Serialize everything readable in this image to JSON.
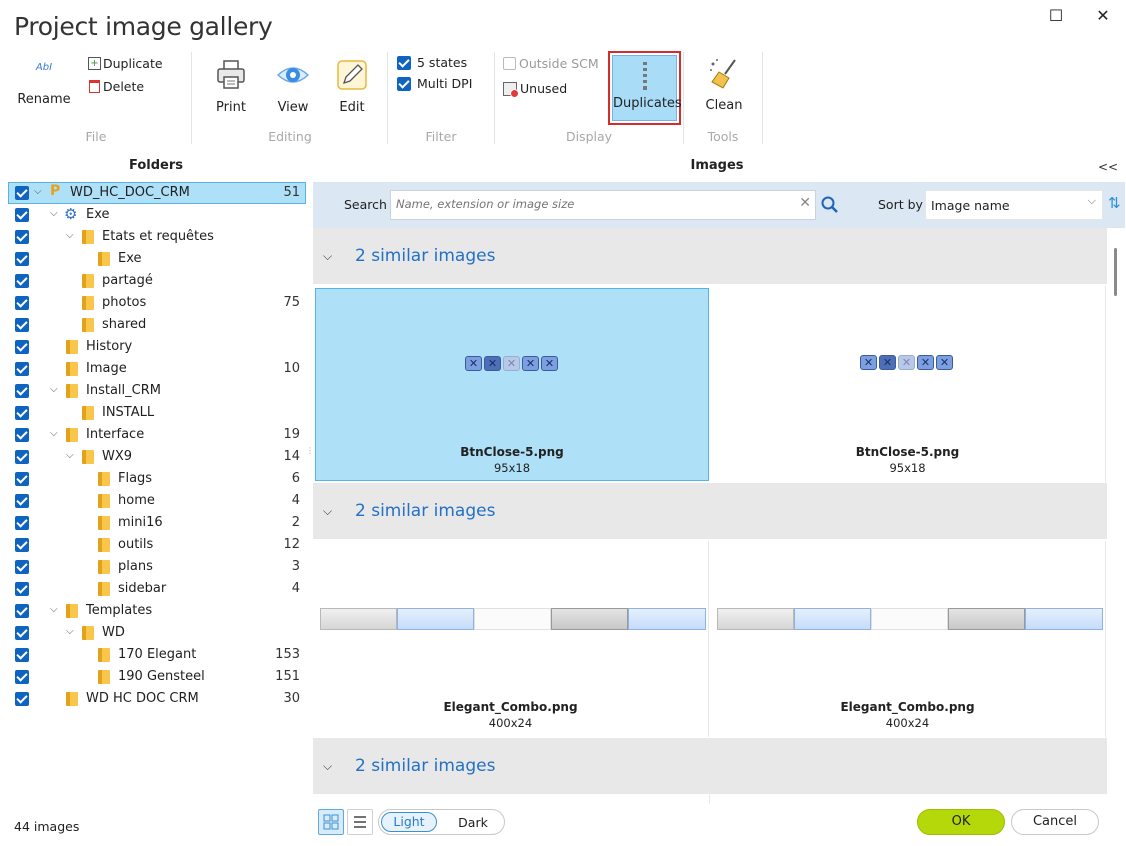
{
  "window": {
    "title": "Project image gallery",
    "maximize_glyph": "☐",
    "close_glyph": "✕"
  },
  "ribbon": {
    "file": {
      "rename": "Rename",
      "duplicate": "Duplicate",
      "delete": "Delete",
      "group": "File"
    },
    "editing": {
      "print": "Print",
      "view": "View",
      "edit": "Edit",
      "group": "Editing"
    },
    "filter": {
      "five_states": "5 states",
      "multi_dpi": "Multi DPI",
      "group": "Filter"
    },
    "display": {
      "outside_scm": "Outside SCM",
      "unused": "Unused",
      "duplicates": "Duplicates",
      "group": "Display"
    },
    "tools": {
      "clean": "Clean",
      "group": "Tools"
    }
  },
  "folders": {
    "title": "Folders",
    "items": [
      {
        "label": "WD_HC_DOC_CRM",
        "count": "51"
      },
      {
        "label": "Exe",
        "count": ""
      },
      {
        "label": "Etats et requêtes",
        "count": ""
      },
      {
        "label": "Exe",
        "count": ""
      },
      {
        "label": "partagé",
        "count": ""
      },
      {
        "label": "photos",
        "count": "75"
      },
      {
        "label": "shared",
        "count": ""
      },
      {
        "label": "History",
        "count": ""
      },
      {
        "label": "Image",
        "count": "10"
      },
      {
        "label": "Install_CRM",
        "count": ""
      },
      {
        "label": "INSTALL",
        "count": ""
      },
      {
        "label": "Interface",
        "count": "19"
      },
      {
        "label": "WX9",
        "count": "14"
      },
      {
        "label": "Flags",
        "count": "6"
      },
      {
        "label": "home",
        "count": "4"
      },
      {
        "label": "mini16",
        "count": "2"
      },
      {
        "label": "outils",
        "count": "12"
      },
      {
        "label": "plans",
        "count": "3"
      },
      {
        "label": "sidebar",
        "count": "4"
      },
      {
        "label": "Templates",
        "count": ""
      },
      {
        "label": "WD",
        "count": ""
      },
      {
        "label": "170 Elegant",
        "count": "153"
      },
      {
        "label": "190 Gensteel",
        "count": "151"
      },
      {
        "label": "WD HC DOC CRM",
        "count": "30"
      }
    ]
  },
  "images": {
    "title": "Images",
    "collapse": "<<",
    "search_label": "Search",
    "search_placeholder": "Name, extension or image size",
    "sort_label": "Sort by",
    "sort_value": "Image name",
    "groups": [
      {
        "label": "2 similar images",
        "items": [
          {
            "name": "BtnClose-5.png",
            "dim": "95x18"
          },
          {
            "name": "BtnClose-5.png",
            "dim": "95x18"
          }
        ]
      },
      {
        "label": "2 similar images",
        "items": [
          {
            "name": "Elegant_Combo.png",
            "dim": "400x24"
          },
          {
            "name": "Elegant_Combo.png",
            "dim": "400x24"
          }
        ]
      },
      {
        "label": "2 similar images",
        "items": []
      }
    ]
  },
  "footer": {
    "count": "44 images",
    "light": "Light",
    "dark": "Dark",
    "ok": "OK",
    "cancel": "Cancel"
  },
  "colors": {
    "accent": "#0f64c0",
    "selection": "#aee0f8",
    "ok_button": "#b5d80a",
    "duplicates_highlight": "#a8dcf7"
  }
}
